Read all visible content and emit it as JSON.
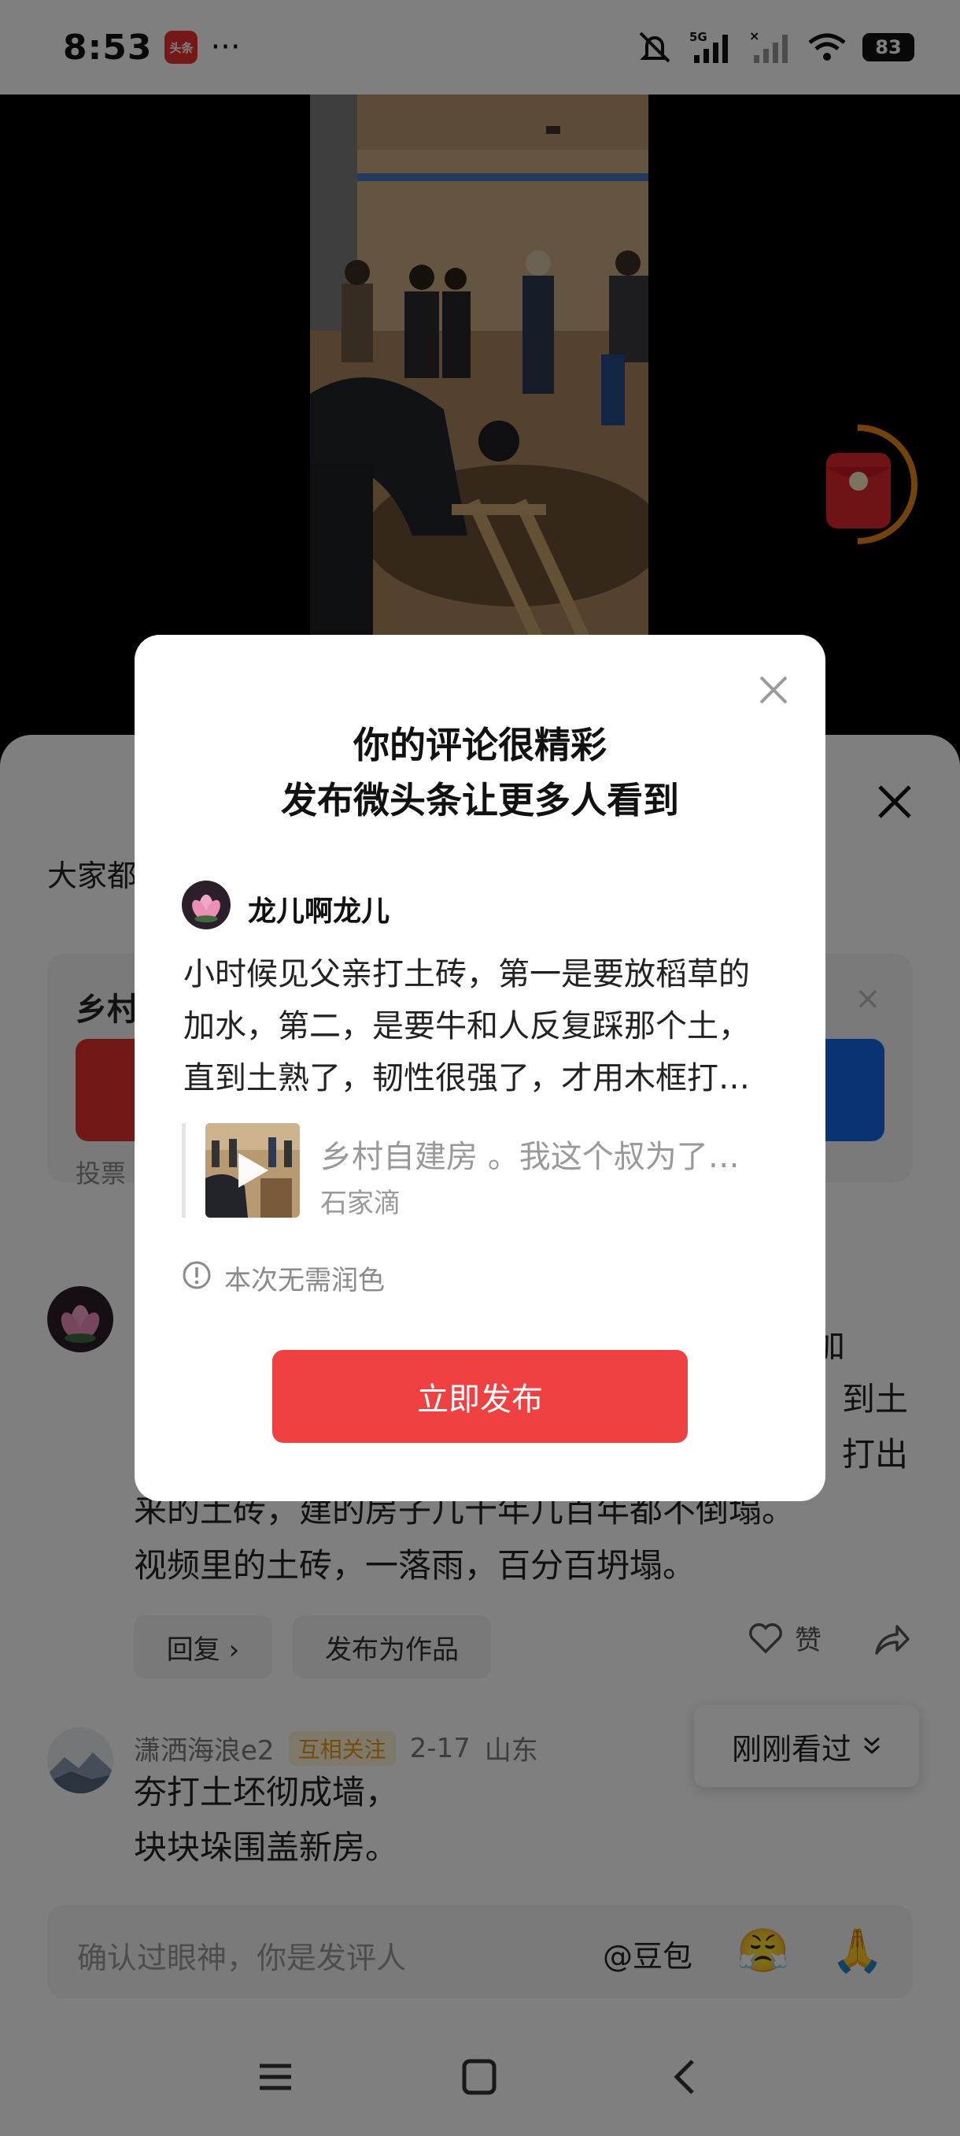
{
  "status_bar": {
    "time": "8:53",
    "app_badge": "头条",
    "more": "···",
    "network": "5G",
    "battery": "83"
  },
  "sheet": {
    "title_fragment": "大家都",
    "vote": {
      "title_fragment": "乡村",
      "count_fragment": "投票",
      "close": "×"
    },
    "comment1": {
      "text_right_1": "加",
      "text_right_2": "到土",
      "text_right_3": "打出",
      "line4": "来的土砖，建的房子几十年几百年都不倒塌。",
      "line5": "视频里的土砖，一落雨，百分百坍塌。",
      "reply_label": "回复 ›",
      "publish_as_work_label": "发布为作品",
      "like_label": "赞"
    },
    "comment2": {
      "username": "潇洒海浪e2",
      "relation_badge": "互相关注",
      "date": "2-17",
      "location": "山东",
      "line1": "夯打土坯彻成墙，",
      "line2": "块块垛围盖新房。"
    },
    "recent_label": "刚刚看过",
    "input": {
      "placeholder": "确认过眼神，你是发评人",
      "at_label": "@豆包",
      "emoji_1": "😤",
      "emoji_2": "🙏"
    }
  },
  "modal": {
    "title_line1": "你的评论很精彩",
    "title_line2": "发布微头条让更多人看到",
    "author_name": "龙儿啊龙儿",
    "comment_lines": [
      "小时候见父亲打土砖，第一是要放稻草的",
      "加水，第二，是要牛和人反复踩那个土，",
      "直到土熟了，韧性很强了，才用木框打…"
    ],
    "quote_title": "乡村自建房 。我这个叔为了…",
    "quote_author": "石家滴",
    "polish_note": "本次无需润色",
    "publish_label": "立即发布"
  },
  "colors": {
    "publish_red": "#f04142",
    "vote_red": "#e2312c",
    "vote_blue": "#1266e4",
    "mutual_badge": "#e49b18"
  }
}
